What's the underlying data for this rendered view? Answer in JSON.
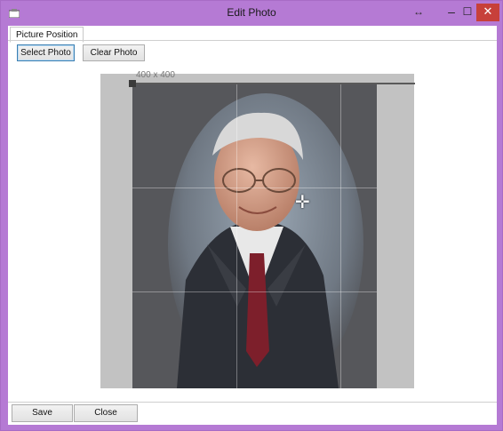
{
  "window": {
    "title": "Edit Photo"
  },
  "tabs": [
    {
      "label": "Picture Position"
    }
  ],
  "toolbar": {
    "select_label": "Select Photo",
    "clear_label": "Clear Photo"
  },
  "photo_editor": {
    "size_label": "400 x 400"
  },
  "footer": {
    "save_label": "Save",
    "close_label": "Close"
  },
  "colors": {
    "titlebar": "#b57ad4",
    "close_button": "#c7403a",
    "frame_background": "#c2c2c2"
  },
  "icons": {
    "app": "app-icon",
    "resize": "resize-icon",
    "minimize": "minimize-icon",
    "maximize": "maximize-icon",
    "close": "close-icon",
    "move": "move-cursor-icon"
  }
}
